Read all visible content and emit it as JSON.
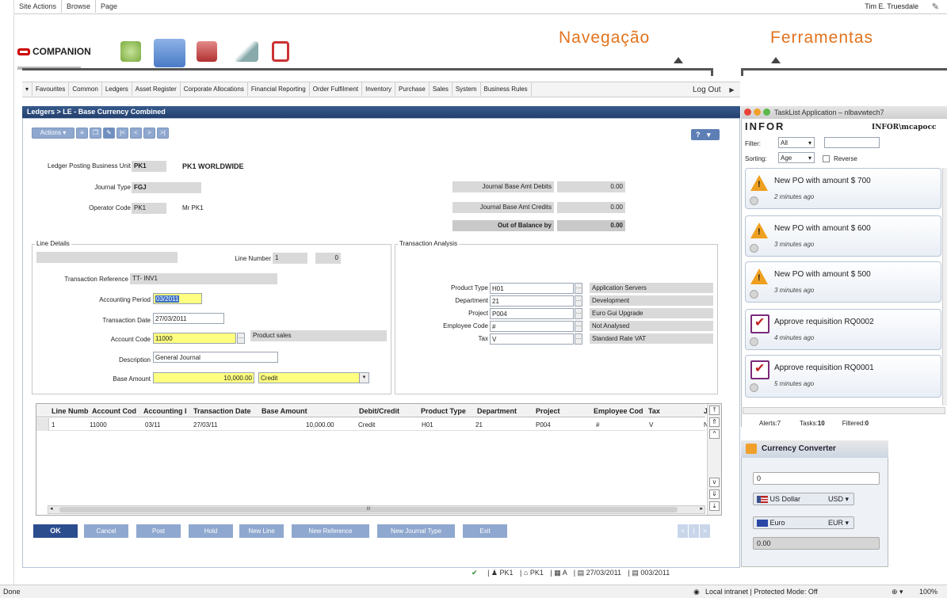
{
  "topbar": {
    "site_actions": "Site Actions",
    "browse": "Browse",
    "page": "Page",
    "user": "Tim E. Truesdale"
  },
  "logo": {
    "text": "COMPANION"
  },
  "annotations": {
    "nav": "Navegação",
    "tools": "Ferramentas"
  },
  "menu": [
    "Favourites",
    "Common",
    "Ledgers",
    "Asset Register",
    "Corporate Allocations",
    "Financial Reporting",
    "Order Fulfilment",
    "Inventory",
    "Purchase",
    "Sales",
    "System",
    "Business Rules"
  ],
  "logout": "Log Out",
  "panel": {
    "title": "Ledgers > LE - Base Currency Combined",
    "actions": "Actions",
    "help": "?"
  },
  "header_fields": {
    "ledger_bu_label": "Ledger Posting Business Unit",
    "ledger_bu_code": "PK1",
    "ledger_bu_name": "PK1 WORLDWIDE",
    "journal_type_label": "Journal Type",
    "journal_type": "FGJ",
    "operator_label": "Operator Code",
    "operator_code": "PK1",
    "operator_name": "Mr PK1",
    "debits_label": "Journal Base Amt Debits",
    "debits": "0.00",
    "credits_label": "Journal Base Amt Credits",
    "credits": "0.00",
    "oob_label": "Out of Balance by",
    "oob": "0.00"
  },
  "line_details": {
    "title": "Line Details",
    "line_number_label": "Line Number",
    "line_number": "1",
    "line_count": "0",
    "trans_ref_label": "Transaction Reference",
    "trans_ref": "TT- INV1",
    "period_label": "Accounting Period",
    "period": "03/2011",
    "trans_date_label": "Transaction Date",
    "trans_date": "27/03/2011",
    "account_label": "Account Code",
    "account": "11000",
    "account_name": "Product sales",
    "desc_label": "Description",
    "desc": "General Journal",
    "base_amount_label": "Base Amount",
    "base_amount": "10,000.00",
    "debit_credit": "Credit"
  },
  "analysis": {
    "title": "Transaction Analysis",
    "rows": [
      {
        "label": "Product Type",
        "code": "H01",
        "name": "Application Servers"
      },
      {
        "label": "Department",
        "code": "21",
        "name": "Development"
      },
      {
        "label": "Project",
        "code": "P004",
        "name": "Euro Gui Upgrade"
      },
      {
        "label": "Employee Code",
        "code": "#",
        "name": "Not Analysed"
      },
      {
        "label": "Tax",
        "code": "V",
        "name": "Standard Rate VAT"
      }
    ]
  },
  "grid": {
    "headers": [
      "Line Numb",
      "Account Cod",
      "Accounting I",
      "Transaction Date",
      "Base Amount",
      "Debit/Credit",
      "Product Type",
      "Department",
      "Project",
      "Employee Cod",
      "Tax",
      "J"
    ],
    "row": [
      "1",
      "11000",
      "03/11",
      "27/03/11",
      "10,000.00",
      "Credit",
      "H01",
      "21",
      "P004",
      "#",
      "V",
      "N"
    ],
    "hscroll_mark": "III"
  },
  "buttons": [
    "OK",
    "Cancel",
    "Post",
    "Hold",
    "New Line",
    "New Reference",
    "New Journal Type",
    "Exit"
  ],
  "status": {
    "check": "✔",
    "user": "PK1",
    "bu": "PK1",
    "lang": "A",
    "date": "27/03/2011",
    "period": "003/2011"
  },
  "browser": {
    "done": "Done",
    "zone": "Local intranet | Protected Mode: Off",
    "zoom": "100%"
  },
  "tasklist": {
    "title": "TaskList Application – nlbavwtech7",
    "brand": "INFOR",
    "user": "INFOR\\mcapocc",
    "filter_label": "Filter:",
    "filter_value": "All",
    "sorting_label": "Sorting:",
    "sorting_value": "Age",
    "reverse_label": "Reverse",
    "tasks": [
      {
        "title": "New PO with amount $ 700",
        "time": "2 minutes ago",
        "kind": "alert"
      },
      {
        "title": "New PO with amount $ 600",
        "time": "3 minutes ago",
        "kind": "alert"
      },
      {
        "title": "New PO with amount $ 500",
        "time": "3 minutes ago",
        "kind": "alert"
      },
      {
        "title": "Approve requisition RQ0002",
        "time": "4 minutes ago",
        "kind": "task"
      },
      {
        "title": "Approve requisition RQ0001",
        "time": "5 minutes ago",
        "kind": "task"
      }
    ],
    "footer": {
      "alerts_label": "Alerts:",
      "alerts": "7",
      "tasks_label": "Tasks:",
      "tasks": "10",
      "filtered_label": "Filtered:",
      "filtered": "0"
    }
  },
  "currency": {
    "title": "Currency Converter",
    "input": "0",
    "from_name": "US Dollar",
    "from_code": "USD",
    "to_name": "Euro",
    "to_code": "EUR",
    "result": "0.00"
  }
}
